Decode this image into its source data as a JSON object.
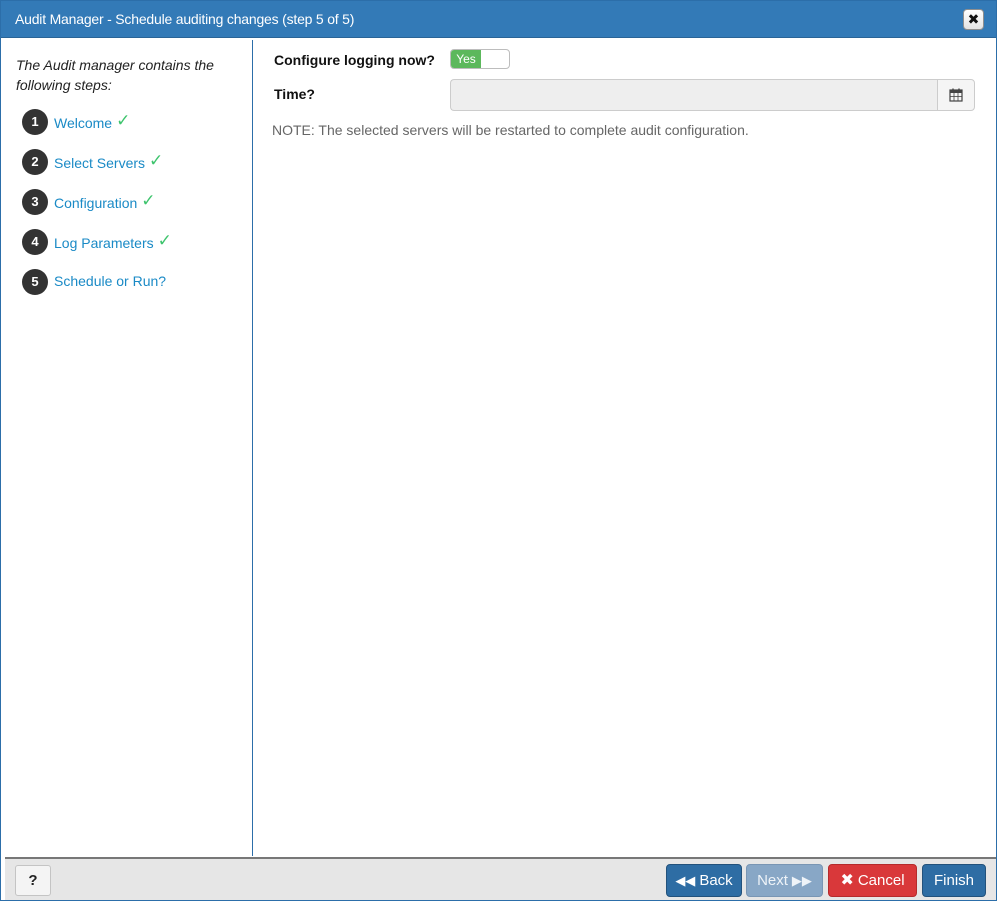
{
  "dialog": {
    "title": "Audit Manager - Schedule auditing changes (step 5 of 5)",
    "close_icon": "close-icon",
    "close_glyph": "✖"
  },
  "sidebar": {
    "intro": "The Audit manager contains the following steps:",
    "steps": [
      {
        "number": "1",
        "label": "Welcome",
        "completed": true
      },
      {
        "number": "2",
        "label": "Select Servers",
        "completed": true
      },
      {
        "number": "3",
        "label": "Configuration",
        "completed": true
      },
      {
        "number": "4",
        "label": "Log Parameters",
        "completed": true
      },
      {
        "number": "5",
        "label": "Schedule or Run?",
        "completed": false
      }
    ],
    "check_glyph": "✓",
    "check_color": "#3ec46d"
  },
  "main": {
    "configure_label": "Configure logging now?",
    "toggle_value": "Yes",
    "toggle_color": "#5cb85c",
    "time_label": "Time?",
    "time_value": "",
    "calendar_icon": "calendar-icon",
    "note": "NOTE: The selected servers will be restarted to complete audit configuration."
  },
  "footer": {
    "help_label": "?",
    "back_label": "Back",
    "back_icon": "double-chevron-left-icon",
    "next_label": "Next",
    "next_icon": "double-chevron-right-icon",
    "cancel_label": "Cancel",
    "cancel_icon": "x-icon",
    "finish_label": "Finish",
    "primary_color": "#2e6da4",
    "danger_color": "#d9383a"
  }
}
